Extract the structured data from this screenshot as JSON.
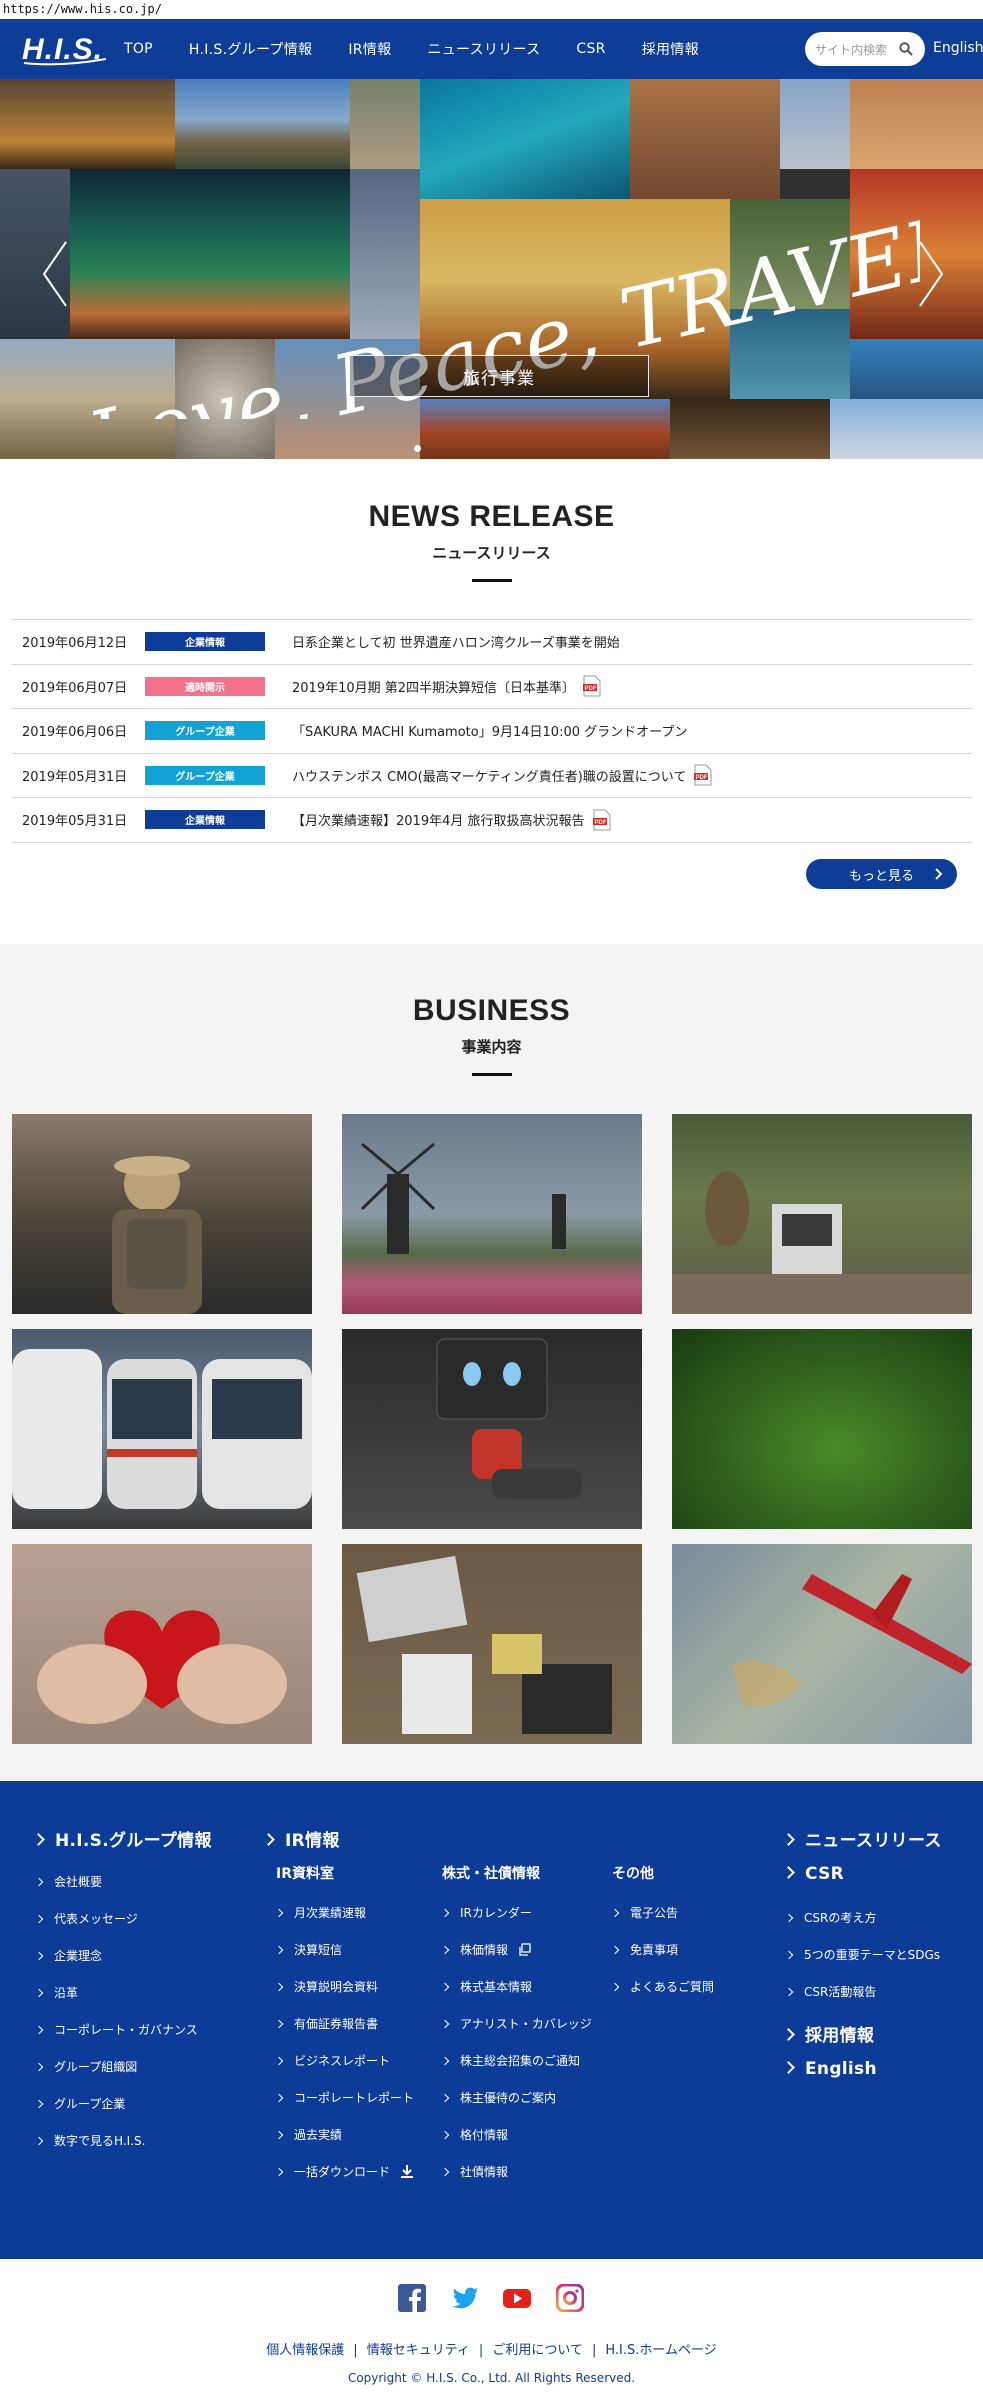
{
  "browser": {
    "url": "https://www.his.co.jp/"
  },
  "header": {
    "nav": [
      {
        "label": "TOP"
      },
      {
        "label": "H.I.S.グループ情報"
      },
      {
        "label": "IR情報"
      },
      {
        "label": "ニュースリリース"
      },
      {
        "label": "CSR"
      },
      {
        "label": "採用情報"
      }
    ],
    "search_placeholder": "サイト内検索",
    "lang_label": "English"
  },
  "hero": {
    "script_text": "Love, Peace, TRAVEL",
    "button_label": "旅行事業"
  },
  "news": {
    "title": "NEWS RELEASE",
    "subtitle": "ニュースリリース",
    "items": [
      {
        "date": "2019年06月12日",
        "badge": "企業情報",
        "badge_color": "#0e3d97",
        "title": "日系企業として初 世界遺産ハロン湾クルーズ事業を開始",
        "pdf": false
      },
      {
        "date": "2019年06月07日",
        "badge": "適時開示",
        "badge_color": "#f0728c",
        "title": "2019年10月期 第2四半期決算短信〔日本基準〕",
        "pdf": true
      },
      {
        "date": "2019年06月06日",
        "badge": "グループ企業",
        "badge_color": "#12a2d3",
        "title": "「SAKURA MACHI Kumamoto」9月14日10:00 グランドオープン",
        "pdf": false
      },
      {
        "date": "2019年05月31日",
        "badge": "グループ企業",
        "badge_color": "#12a2d3",
        "title": "ハウステンボス CMO(最高マーケティング責任者)職の設置について",
        "pdf": true
      },
      {
        "date": "2019年05月31日",
        "badge": "企業情報",
        "badge_color": "#0e3d97",
        "title": "【月次業績速報】2019年4月 旅行取扱高状況報告",
        "pdf": true
      }
    ],
    "more_label": "もっと見る"
  },
  "business": {
    "title": "BUSINESS",
    "subtitle": "事業内容"
  },
  "footer": {
    "group": {
      "heading": "H.I.S.グループ情報",
      "links": [
        "会社概要",
        "代表メッセージ",
        "企業理念",
        "沿革",
        "コーポレート・ガバナンス",
        "グループ組織図",
        "グループ企業",
        "数字で見るH.I.S."
      ]
    },
    "ir": {
      "heading": "IR情報",
      "col1_heading": "IR資料室",
      "col1": [
        "月次業績速報",
        "決算短信",
        "決算説明会資料",
        "有価証券報告書",
        "ビジネスレポート",
        "コーポレートレポート",
        "過去実績",
        "一括ダウンロード"
      ],
      "col2_heading": "株式・社債情報",
      "col2": [
        "IRカレンダー",
        "株価情報",
        "株式基本情報",
        "アナリスト・カバレッジ",
        "株主総会招集のご通知",
        "株主優待のご案内",
        "格付情報",
        "社債情報"
      ],
      "col3_heading": "その他",
      "col3": [
        "電子公告",
        "免責事項",
        "よくあるご質問"
      ]
    },
    "right": {
      "news_heading": "ニュースリリース",
      "csr_heading": "CSR",
      "csr_links": [
        "CSRの考え方",
        "5つの重要テーマとSDGs",
        "CSR活動報告"
      ],
      "recruit_heading": "採用情報",
      "english_heading": "English"
    }
  },
  "bottom": {
    "links": [
      "個人情報保護",
      "情報セキュリティ",
      "ご利用について",
      "H.I.S.ホームページ"
    ],
    "copyright": "Copyright © H.I.S. Co., Ltd. All Rights Reserved."
  },
  "colors": {
    "brand": "#0e3d97",
    "footer": "#0c3b98",
    "business_bg": "#f4f4f4"
  },
  "icons": [
    "search-icon",
    "pdf-icon",
    "download-icon",
    "external-window-icon",
    "facebook-icon",
    "twitter-icon",
    "youtube-icon",
    "instagram-icon"
  ]
}
